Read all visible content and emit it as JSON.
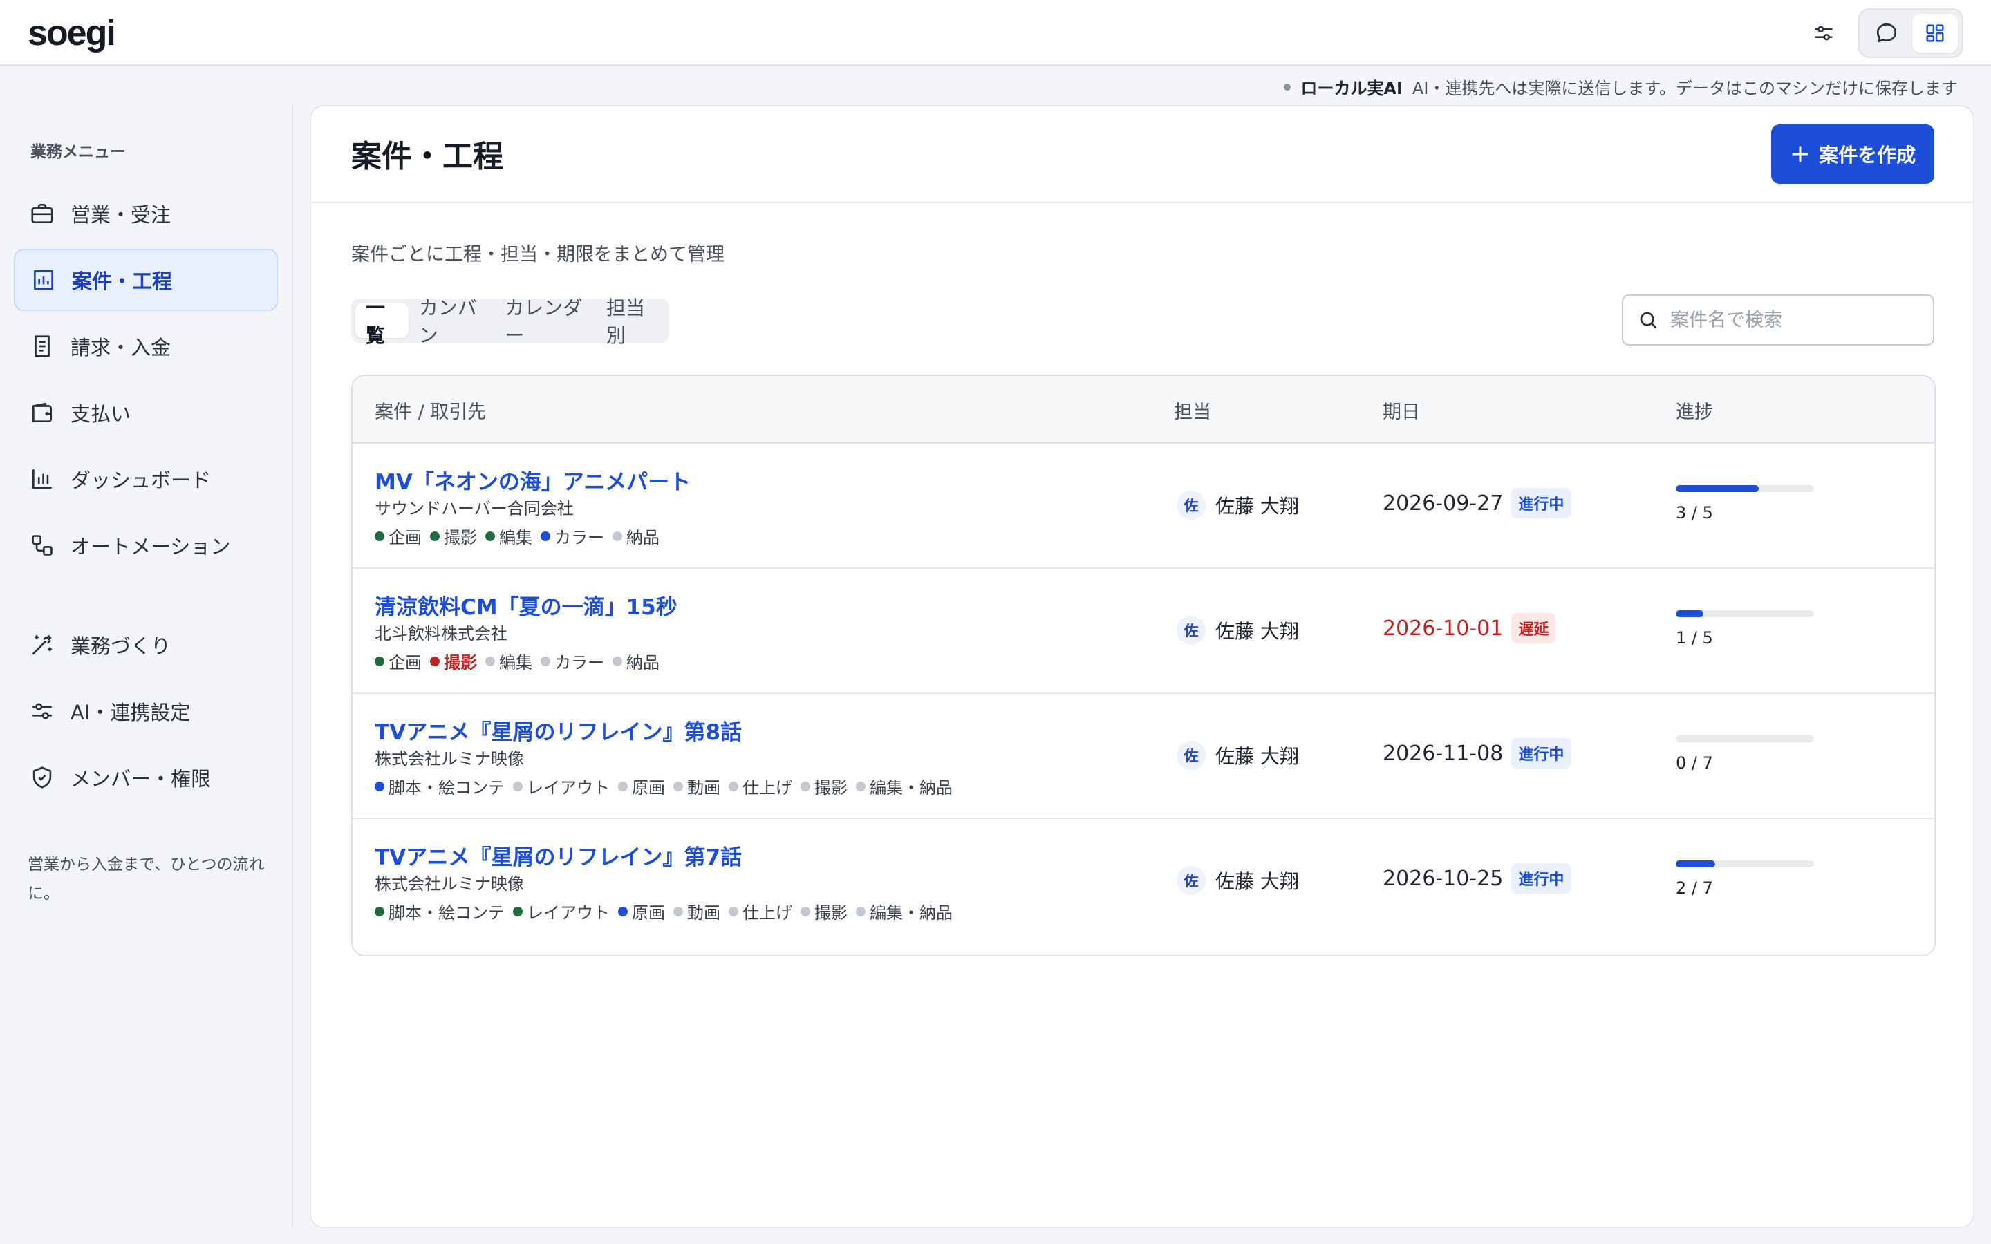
{
  "app": {
    "name": "soegi"
  },
  "notice": {
    "label": "ローカル実AI",
    "message": "AI・連携先へは実際に送信します。データはこのマシンだけに保存します"
  },
  "sidebar": {
    "heading": "業務メニュー",
    "items": [
      {
        "label": "営業・受注",
        "icon": "briefcase-icon"
      },
      {
        "label": "案件・工程",
        "icon": "project-chart-icon",
        "active": true
      },
      {
        "label": "請求・入金",
        "icon": "invoice-icon"
      },
      {
        "label": "支払い",
        "icon": "wallet-icon"
      },
      {
        "label": "ダッシュボード",
        "icon": "bar-chart-icon"
      },
      {
        "label": "オートメーション",
        "icon": "workflow-icon"
      },
      {
        "label": "業務づくり",
        "icon": "magic-wand-icon"
      },
      {
        "label": "AI・連携設定",
        "icon": "sliders-icon"
      },
      {
        "label": "メンバー・権限",
        "icon": "shield-check-icon"
      }
    ],
    "footer": "営業から入金まで、ひとつの流れに。"
  },
  "main": {
    "title": "案件・工程",
    "create_label": "案件を作成",
    "subtitle": "案件ごとに工程・担当・期限をまとめて管理",
    "tabs": [
      {
        "label": "一覧",
        "active": true
      },
      {
        "label": "カンバン"
      },
      {
        "label": "カレンダー"
      },
      {
        "label": "担当別"
      }
    ],
    "search_placeholder": "案件名で検索",
    "columns": [
      "案件 / 取引先",
      "担当",
      "期日",
      "進捗"
    ],
    "rows": [
      {
        "name": "MV「ネオンの海」アニメパート",
        "client": "サウンドハーバー合同会社",
        "stages": [
          {
            "label": "企画",
            "state": "done"
          },
          {
            "label": "撮影",
            "state": "done"
          },
          {
            "label": "編集",
            "state": "done"
          },
          {
            "label": "カラー",
            "state": "current"
          },
          {
            "label": "納品",
            "state": "todo"
          }
        ],
        "owner_initial": "佐",
        "owner": "佐藤 大翔",
        "due": "2026-09-27",
        "status": "進行中",
        "status_type": "ok",
        "progress_done": 3,
        "progress_total": 5,
        "progress_text": "3 / 5"
      },
      {
        "name": "清涼飲料CM「夏の一滴」15秒",
        "client": "北斗飲料株式会社",
        "stages": [
          {
            "label": "企画",
            "state": "done"
          },
          {
            "label": "撮影",
            "state": "late"
          },
          {
            "label": "編集",
            "state": "todo"
          },
          {
            "label": "カラー",
            "state": "todo"
          },
          {
            "label": "納品",
            "state": "todo"
          }
        ],
        "owner_initial": "佐",
        "owner": "佐藤 大翔",
        "due": "2026-10-01",
        "status": "遅延",
        "status_type": "late",
        "progress_done": 1,
        "progress_total": 5,
        "progress_text": "1 / 5"
      },
      {
        "name": "TVアニメ『星屑のリフレイン』第8話",
        "client": "株式会社ルミナ映像",
        "stages": [
          {
            "label": "脚本・絵コンテ",
            "state": "current"
          },
          {
            "label": "レイアウト",
            "state": "todo"
          },
          {
            "label": "原画",
            "state": "todo"
          },
          {
            "label": "動画",
            "state": "todo"
          },
          {
            "label": "仕上げ",
            "state": "todo"
          },
          {
            "label": "撮影",
            "state": "todo"
          },
          {
            "label": "編集・納品",
            "state": "todo"
          }
        ],
        "owner_initial": "佐",
        "owner": "佐藤 大翔",
        "due": "2026-11-08",
        "status": "進行中",
        "status_type": "ok",
        "progress_done": 0,
        "progress_total": 7,
        "progress_text": "0 / 7"
      },
      {
        "name": "TVアニメ『星屑のリフレイン』第7話",
        "client": "株式会社ルミナ映像",
        "stages": [
          {
            "label": "脚本・絵コンテ",
            "state": "done"
          },
          {
            "label": "レイアウト",
            "state": "done"
          },
          {
            "label": "原画",
            "state": "current"
          },
          {
            "label": "動画",
            "state": "todo"
          },
          {
            "label": "仕上げ",
            "state": "todo"
          },
          {
            "label": "撮影",
            "state": "todo"
          },
          {
            "label": "編集・納品",
            "state": "todo"
          }
        ],
        "owner_initial": "佐",
        "owner": "佐藤 大翔",
        "due": "2026-10-25",
        "status": "進行中",
        "status_type": "ok",
        "progress_done": 2,
        "progress_total": 7,
        "progress_text": "2 / 7"
      }
    ]
  },
  "colors": {
    "accent": "#1d4ed8",
    "late": "#c0211f",
    "done": "#1e6b3e",
    "todo": "#c4c8d0"
  }
}
